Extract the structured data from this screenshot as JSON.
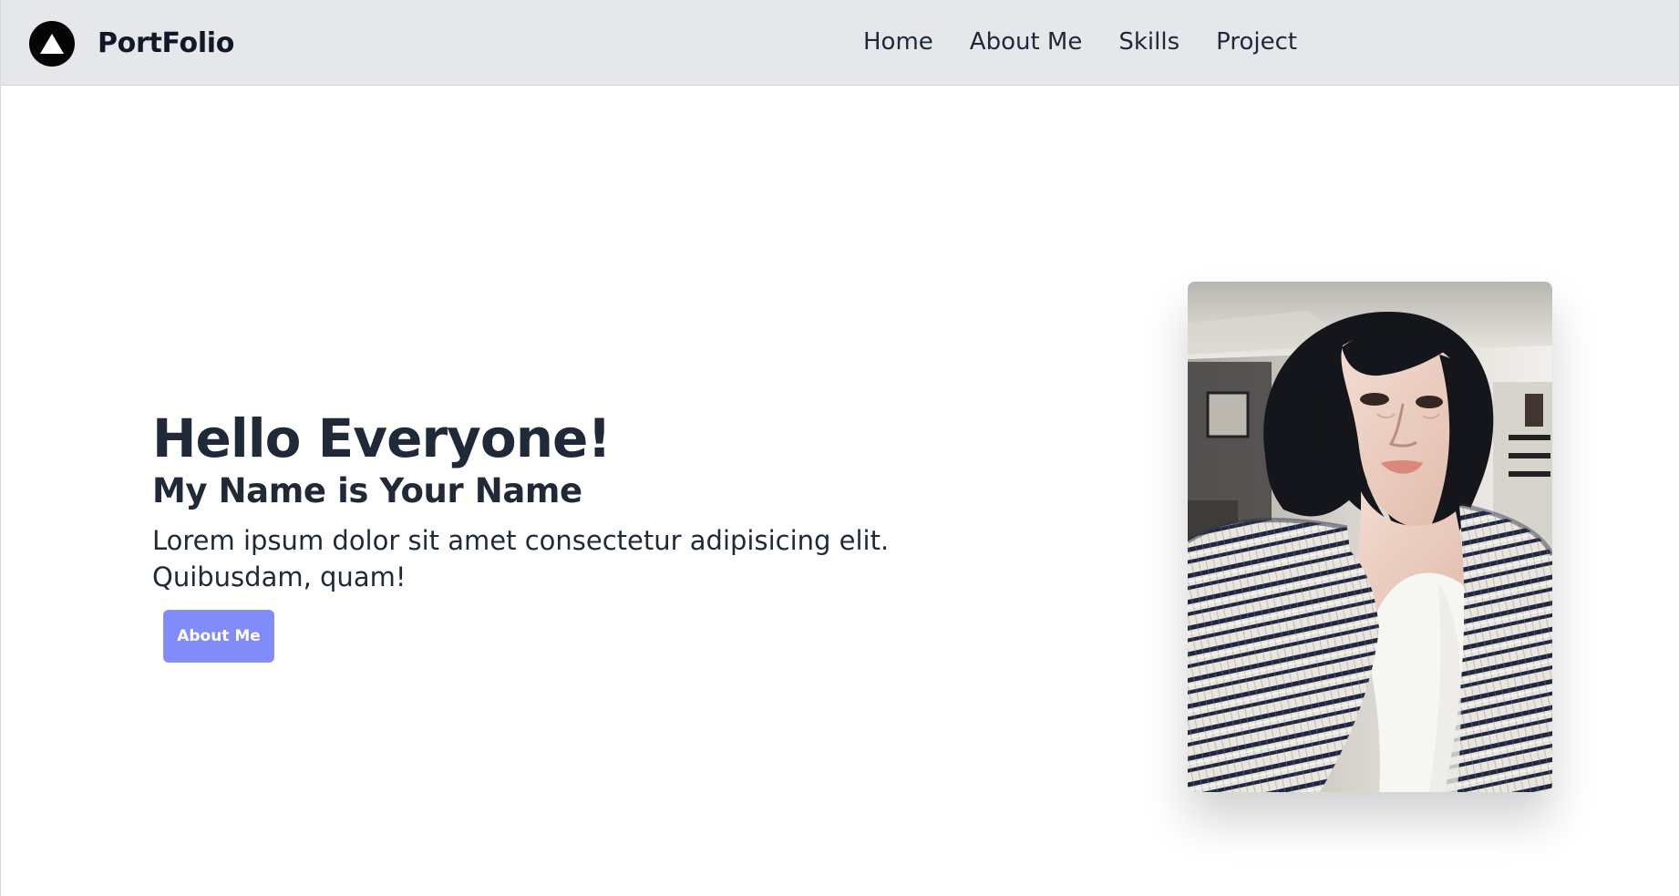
{
  "header": {
    "brand": "PortFolio",
    "logo_icon": "triangle-logo-icon",
    "nav": [
      {
        "label": "Home"
      },
      {
        "label": "About Me"
      },
      {
        "label": "Skills"
      },
      {
        "label": "Project"
      }
    ]
  },
  "hero": {
    "title": "Hello Everyone!",
    "subtitle": "My Name is Your Name",
    "description": "Lorem ipsum dolor sit amet consectetur adipisicing elit. Quibusdam, quam!",
    "button_label": "About Me"
  },
  "colors": {
    "navbar_background": "#e5e7eb",
    "button_background": "#818cf8",
    "text_primary": "#1f2937"
  },
  "image": {
    "subject": "portrait photo"
  }
}
